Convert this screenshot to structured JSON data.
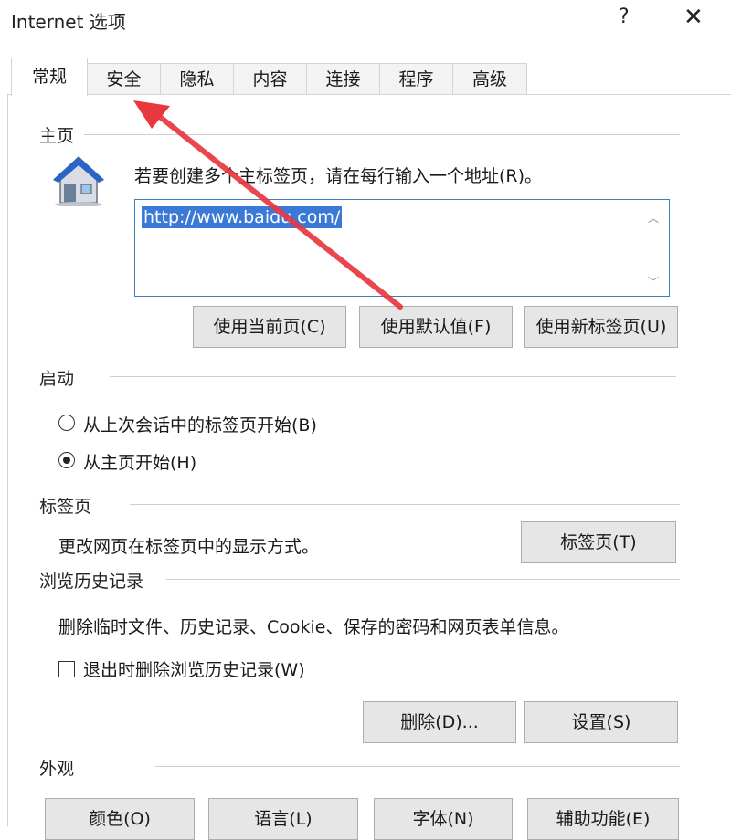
{
  "window": {
    "title": "Internet 选项",
    "help": "?",
    "close": "✕"
  },
  "tabs": [
    "常规",
    "安全",
    "隐私",
    "内容",
    "连接",
    "程序",
    "高级"
  ],
  "home": {
    "group": "主页",
    "description": "若要创建多个主标签页，请在每行输入一个地址(R)。",
    "url": "http://www.baidu.com/",
    "buttons": [
      "使用当前页(C)",
      "使用默认值(F)",
      "使用新标签页(U)"
    ]
  },
  "startup": {
    "group": "启动",
    "options": [
      "从上次会话中的标签页开始(B)",
      "从主页开始(H)"
    ],
    "selected_index": 1
  },
  "tabsection": {
    "group": "标签页",
    "description": "更改网页在标签页中的显示方式。",
    "button": "标签页(T)"
  },
  "history": {
    "group": "浏览历史记录",
    "description": "删除临时文件、历史记录、Cookie、保存的密码和网页表单信息。",
    "checkbox": "退出时删除浏览历史记录(W)",
    "checkbox_checked": false,
    "buttons": [
      "删除(D)...",
      "设置(S)"
    ]
  },
  "appearance": {
    "group": "外观",
    "buttons": [
      "颜色(O)",
      "语言(L)",
      "字体(N)",
      "辅助功能(E)"
    ]
  },
  "colors": {
    "accent": "#3a7ad6",
    "arrow": "#e8373f"
  },
  "icons": [
    "help-icon",
    "close-icon",
    "home-icon",
    "scroll-up-icon",
    "scroll-down-icon",
    "annotation-arrow-icon"
  ]
}
